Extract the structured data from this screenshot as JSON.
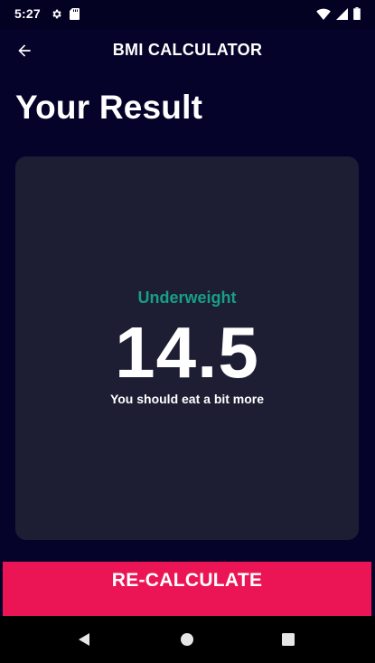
{
  "status_bar": {
    "time": "5:27",
    "icons": [
      "settings-icon",
      "sd-card-icon",
      "wifi-icon",
      "signal-icon",
      "battery-icon"
    ]
  },
  "app_bar": {
    "back_icon": "arrow-back-icon",
    "title": "BMI CALCULATOR"
  },
  "page": {
    "title": "Your Result"
  },
  "result": {
    "category": "Underweight",
    "bmi": "14.5",
    "advice": "You should eat a bit more"
  },
  "button": {
    "label": "RE-CALCULATE"
  },
  "nav_bar": {
    "buttons": [
      "back-triangle-icon",
      "home-circle-icon",
      "recents-square-icon"
    ]
  },
  "colors": {
    "background": "#050329",
    "card": "#1d1e33",
    "category_text": "#17a085",
    "accent_button": "#eb1555"
  }
}
